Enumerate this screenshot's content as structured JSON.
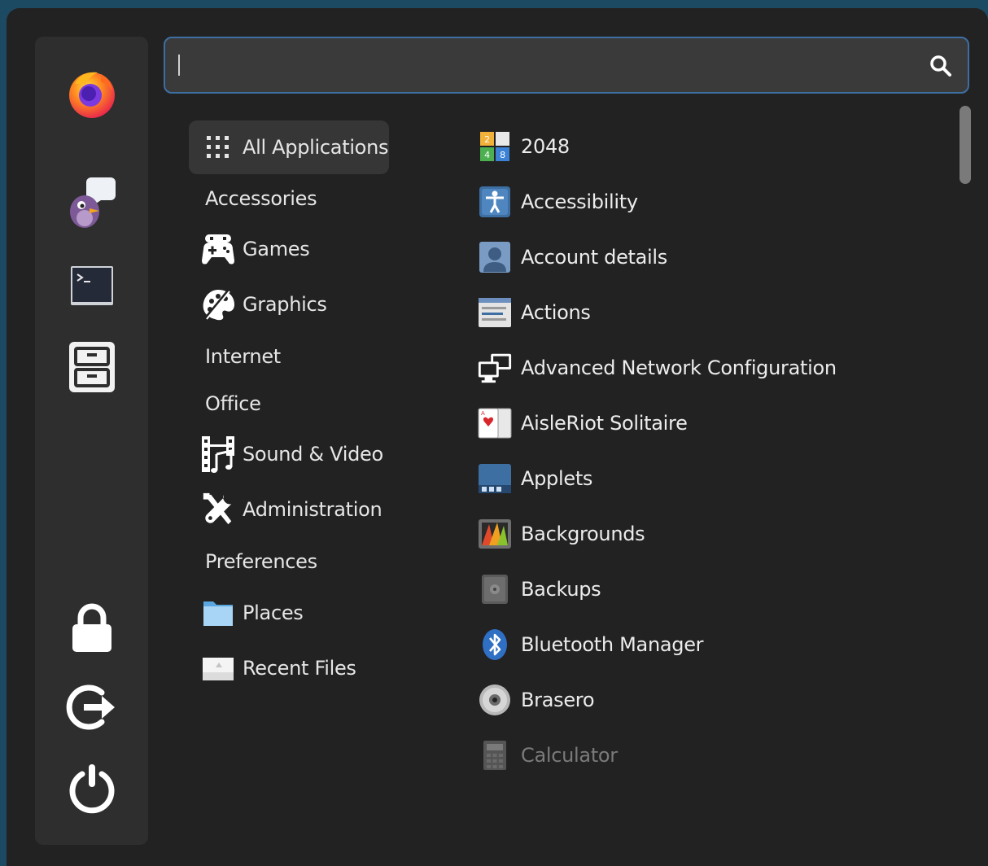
{
  "search": {
    "value": "",
    "placeholder": ""
  },
  "sidebar": {
    "favorites": [
      {
        "name": "firefox",
        "icon": "firefox-icon"
      },
      {
        "name": "pidgin",
        "icon": "pidgin-icon"
      },
      {
        "name": "terminal",
        "icon": "terminal-icon"
      },
      {
        "name": "files",
        "icon": "file-cabinet-icon"
      }
    ],
    "actions": [
      {
        "name": "lock",
        "icon": "lock-icon"
      },
      {
        "name": "logout",
        "icon": "logout-icon"
      },
      {
        "name": "shutdown",
        "icon": "power-icon"
      }
    ]
  },
  "categories": [
    {
      "label": "All Applications",
      "icon": "grid-icon",
      "active": true
    },
    {
      "label": "Accessories",
      "icon": ""
    },
    {
      "label": "Games",
      "icon": "gamepad-icon"
    },
    {
      "label": "Graphics",
      "icon": "palette-icon"
    },
    {
      "label": "Internet",
      "icon": ""
    },
    {
      "label": "Office",
      "icon": ""
    },
    {
      "label": "Sound & Video",
      "icon": "film-music-icon"
    },
    {
      "label": "Administration",
      "icon": "tools-icon"
    },
    {
      "label": "Preferences",
      "icon": ""
    },
    {
      "label": "Places",
      "icon": "folder-icon"
    },
    {
      "label": "Recent Files",
      "icon": "recent-file-icon"
    }
  ],
  "apps": [
    {
      "label": "2048",
      "icon": "2048-icon"
    },
    {
      "label": "Accessibility",
      "icon": "accessibility-icon"
    },
    {
      "label": "Account details",
      "icon": "user-account-icon"
    },
    {
      "label": "Actions",
      "icon": "actions-icon"
    },
    {
      "label": "Advanced Network Configuration",
      "icon": "network-icon"
    },
    {
      "label": "AisleRiot Solitaire",
      "icon": "cards-icon"
    },
    {
      "label": "Applets",
      "icon": "applets-icon"
    },
    {
      "label": "Backgrounds",
      "icon": "backgrounds-icon"
    },
    {
      "label": "Backups",
      "icon": "backups-icon"
    },
    {
      "label": "Bluetooth Manager",
      "icon": "bluetooth-icon"
    },
    {
      "label": "Brasero",
      "icon": "disc-icon"
    },
    {
      "label": "Calculator",
      "icon": "calculator-icon"
    }
  ],
  "colors": {
    "accent": "#3d6fa3",
    "background": "#222222",
    "sidebar": "#2e2e2e",
    "active_item": "#363636"
  }
}
